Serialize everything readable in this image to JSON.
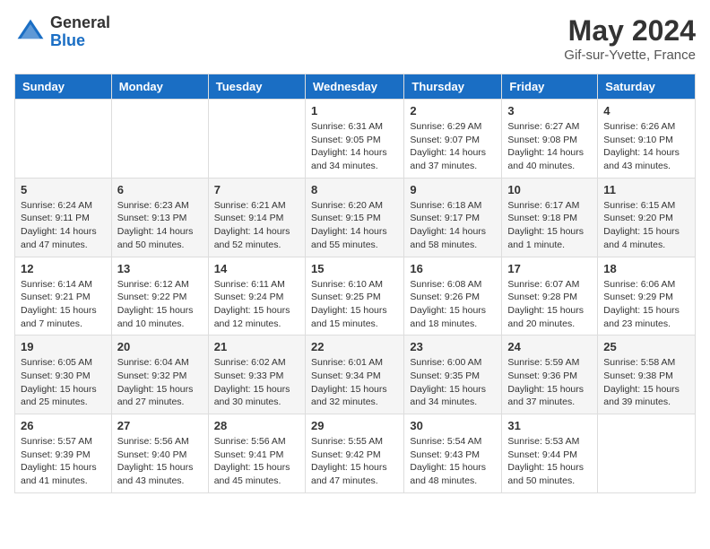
{
  "header": {
    "logo_general": "General",
    "logo_blue": "Blue",
    "month_year": "May 2024",
    "subtitle": "Gif-sur-Yvette, France"
  },
  "weekdays": [
    "Sunday",
    "Monday",
    "Tuesday",
    "Wednesday",
    "Thursday",
    "Friday",
    "Saturday"
  ],
  "weeks": [
    {
      "alt": false,
      "days": [
        {
          "number": "",
          "info": ""
        },
        {
          "number": "",
          "info": ""
        },
        {
          "number": "",
          "info": ""
        },
        {
          "number": "1",
          "info": "Sunrise: 6:31 AM\nSunset: 9:05 PM\nDaylight: 14 hours and 34 minutes."
        },
        {
          "number": "2",
          "info": "Sunrise: 6:29 AM\nSunset: 9:07 PM\nDaylight: 14 hours and 37 minutes."
        },
        {
          "number": "3",
          "info": "Sunrise: 6:27 AM\nSunset: 9:08 PM\nDaylight: 14 hours and 40 minutes."
        },
        {
          "number": "4",
          "info": "Sunrise: 6:26 AM\nSunset: 9:10 PM\nDaylight: 14 hours and 43 minutes."
        }
      ]
    },
    {
      "alt": true,
      "days": [
        {
          "number": "5",
          "info": "Sunrise: 6:24 AM\nSunset: 9:11 PM\nDaylight: 14 hours and 47 minutes."
        },
        {
          "number": "6",
          "info": "Sunrise: 6:23 AM\nSunset: 9:13 PM\nDaylight: 14 hours and 50 minutes."
        },
        {
          "number": "7",
          "info": "Sunrise: 6:21 AM\nSunset: 9:14 PM\nDaylight: 14 hours and 52 minutes."
        },
        {
          "number": "8",
          "info": "Sunrise: 6:20 AM\nSunset: 9:15 PM\nDaylight: 14 hours and 55 minutes."
        },
        {
          "number": "9",
          "info": "Sunrise: 6:18 AM\nSunset: 9:17 PM\nDaylight: 14 hours and 58 minutes."
        },
        {
          "number": "10",
          "info": "Sunrise: 6:17 AM\nSunset: 9:18 PM\nDaylight: 15 hours and 1 minute."
        },
        {
          "number": "11",
          "info": "Sunrise: 6:15 AM\nSunset: 9:20 PM\nDaylight: 15 hours and 4 minutes."
        }
      ]
    },
    {
      "alt": false,
      "days": [
        {
          "number": "12",
          "info": "Sunrise: 6:14 AM\nSunset: 9:21 PM\nDaylight: 15 hours and 7 minutes."
        },
        {
          "number": "13",
          "info": "Sunrise: 6:12 AM\nSunset: 9:22 PM\nDaylight: 15 hours and 10 minutes."
        },
        {
          "number": "14",
          "info": "Sunrise: 6:11 AM\nSunset: 9:24 PM\nDaylight: 15 hours and 12 minutes."
        },
        {
          "number": "15",
          "info": "Sunrise: 6:10 AM\nSunset: 9:25 PM\nDaylight: 15 hours and 15 minutes."
        },
        {
          "number": "16",
          "info": "Sunrise: 6:08 AM\nSunset: 9:26 PM\nDaylight: 15 hours and 18 minutes."
        },
        {
          "number": "17",
          "info": "Sunrise: 6:07 AM\nSunset: 9:28 PM\nDaylight: 15 hours and 20 minutes."
        },
        {
          "number": "18",
          "info": "Sunrise: 6:06 AM\nSunset: 9:29 PM\nDaylight: 15 hours and 23 minutes."
        }
      ]
    },
    {
      "alt": true,
      "days": [
        {
          "number": "19",
          "info": "Sunrise: 6:05 AM\nSunset: 9:30 PM\nDaylight: 15 hours and 25 minutes."
        },
        {
          "number": "20",
          "info": "Sunrise: 6:04 AM\nSunset: 9:32 PM\nDaylight: 15 hours and 27 minutes."
        },
        {
          "number": "21",
          "info": "Sunrise: 6:02 AM\nSunset: 9:33 PM\nDaylight: 15 hours and 30 minutes."
        },
        {
          "number": "22",
          "info": "Sunrise: 6:01 AM\nSunset: 9:34 PM\nDaylight: 15 hours and 32 minutes."
        },
        {
          "number": "23",
          "info": "Sunrise: 6:00 AM\nSunset: 9:35 PM\nDaylight: 15 hours and 34 minutes."
        },
        {
          "number": "24",
          "info": "Sunrise: 5:59 AM\nSunset: 9:36 PM\nDaylight: 15 hours and 37 minutes."
        },
        {
          "number": "25",
          "info": "Sunrise: 5:58 AM\nSunset: 9:38 PM\nDaylight: 15 hours and 39 minutes."
        }
      ]
    },
    {
      "alt": false,
      "days": [
        {
          "number": "26",
          "info": "Sunrise: 5:57 AM\nSunset: 9:39 PM\nDaylight: 15 hours and 41 minutes."
        },
        {
          "number": "27",
          "info": "Sunrise: 5:56 AM\nSunset: 9:40 PM\nDaylight: 15 hours and 43 minutes."
        },
        {
          "number": "28",
          "info": "Sunrise: 5:56 AM\nSunset: 9:41 PM\nDaylight: 15 hours and 45 minutes."
        },
        {
          "number": "29",
          "info": "Sunrise: 5:55 AM\nSunset: 9:42 PM\nDaylight: 15 hours and 47 minutes."
        },
        {
          "number": "30",
          "info": "Sunrise: 5:54 AM\nSunset: 9:43 PM\nDaylight: 15 hours and 48 minutes."
        },
        {
          "number": "31",
          "info": "Sunrise: 5:53 AM\nSunset: 9:44 PM\nDaylight: 15 hours and 50 minutes."
        },
        {
          "number": "",
          "info": ""
        }
      ]
    }
  ]
}
